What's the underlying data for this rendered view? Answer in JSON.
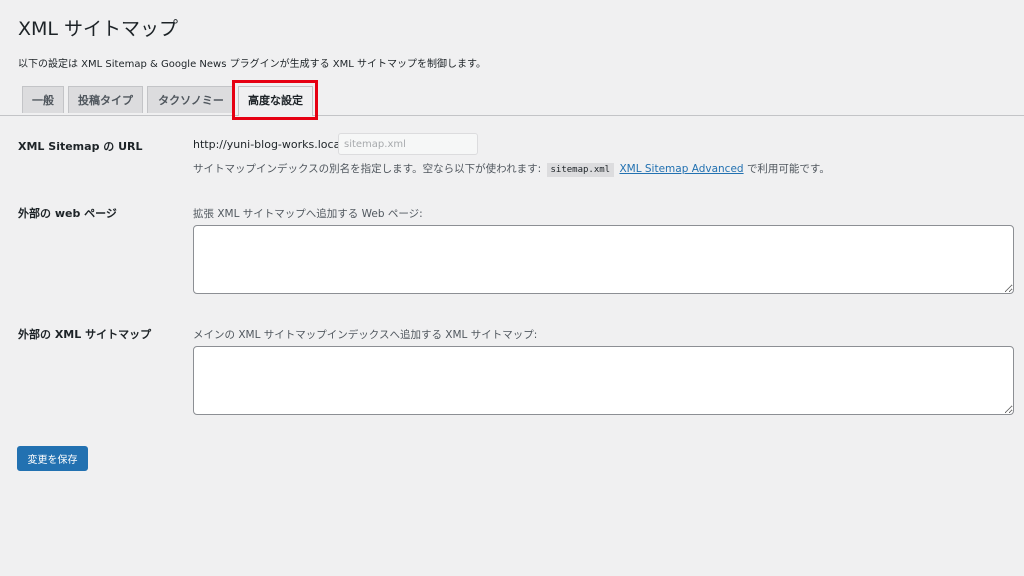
{
  "page": {
    "title": "XML サイトマップ",
    "description": "以下の設定は XML Sitemap & Google News プラグインが生成する XML サイトマップを制御します。"
  },
  "tabs": [
    {
      "label": "一般",
      "active": false
    },
    {
      "label": "投稿タイプ",
      "active": false
    },
    {
      "label": "タクソノミー",
      "active": false
    },
    {
      "label": "高度な設定",
      "active": true
    }
  ],
  "sitemap_url": {
    "label": "XML Sitemap の URL",
    "prefix": "http://yuni-blog-works.local/",
    "placeholder": "sitemap.xml",
    "value": "",
    "hint_before": "サイトマップインデックスの別名を指定します。空なら以下が使われます:",
    "hint_code": "sitemap.xml",
    "hint_link": "XML Sitemap Advanced",
    "hint_after": "で利用可能です。"
  },
  "external_web": {
    "label": "外部の web ページ",
    "field_label": "拡張 XML サイトマップへ追加する Web ページ:",
    "value": ""
  },
  "external_sitemap": {
    "label": "外部の XML サイトマップ",
    "field_label": "メインの XML サイトマップインデックスへ追加する XML サイトマップ:",
    "value": ""
  },
  "save_button": "変更を保存",
  "colors": {
    "accent": "#2271b1",
    "highlight": "#e60012",
    "background": "#f0f0f1"
  }
}
